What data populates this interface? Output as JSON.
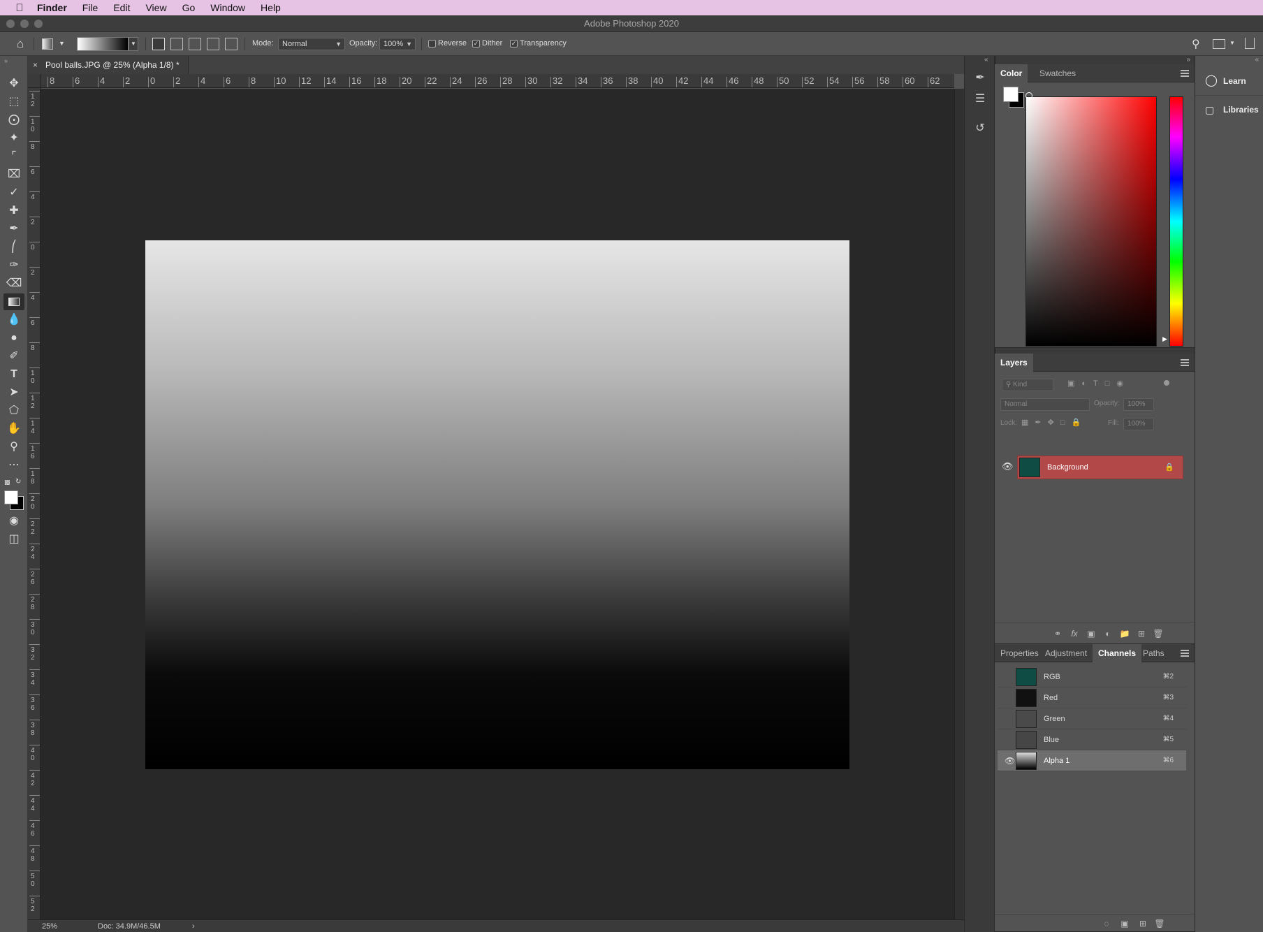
{
  "menubar": {
    "apple": "",
    "items": [
      "Finder",
      "File",
      "Edit",
      "View",
      "Go",
      "Window",
      "Help"
    ]
  },
  "window": {
    "title": "Adobe Photoshop 2020"
  },
  "options": {
    "mode_label": "Mode:",
    "mode_value": "Normal",
    "opacity_label": "Opacity:",
    "opacity_value": "100%",
    "reverse_label": "Reverse",
    "reverse_checked": false,
    "dither_label": "Dither",
    "dither_checked": true,
    "transparency_label": "Transparency",
    "transparency_checked": true
  },
  "document": {
    "tab_title": "Pool balls.JPG @ 25% (Alpha 1/8) *",
    "close_glyph": "×",
    "zoom": "25%",
    "doc_info": "Doc: 34.9M/46.5M"
  },
  "rulers": {
    "horizontal": [
      "8",
      "6",
      "4",
      "2",
      "0",
      "2",
      "4",
      "6",
      "8",
      "10",
      "12",
      "14",
      "16",
      "18",
      "20",
      "22",
      "24",
      "26",
      "28",
      "30",
      "32",
      "34",
      "36",
      "38",
      "40",
      "42",
      "44",
      "46",
      "48",
      "50",
      "52",
      "54",
      "56",
      "58",
      "60",
      "62"
    ],
    "vertical": [
      "12",
      "10",
      "8",
      "6",
      "4",
      "2",
      "0",
      "2",
      "4",
      "6",
      "8",
      "10",
      "12",
      "14",
      "16",
      "18",
      "20",
      "22",
      "24",
      "26",
      "28",
      "30",
      "32",
      "34",
      "36",
      "38",
      "40",
      "42",
      "44",
      "46",
      "48",
      "50",
      "52"
    ]
  },
  "toolbar": {
    "tools": [
      "move-tool",
      "marquee-tool",
      "lasso-tool",
      "magic-wand-tool",
      "crop-tool",
      "frame-tool",
      "eyedropper-tool",
      "healing-tool",
      "brush-tool",
      "stamp-tool",
      "history-brush-tool",
      "eraser-tool",
      "gradient-tool",
      "blur-tool",
      "dodge-tool",
      "pen-tool",
      "type-tool",
      "path-select-tool",
      "shape-tool",
      "hand-tool",
      "zoom-tool",
      "more-tools"
    ],
    "active": "gradient-tool"
  },
  "color_panel": {
    "tabs": [
      "Color",
      "Swatches"
    ],
    "active_tab": "Color",
    "foreground": "#ffffff",
    "background": "#000000"
  },
  "layers_panel": {
    "title": "Layers",
    "kind_placeholder": "Kind",
    "blend_mode": "Normal",
    "opacity_label": "Opacity:",
    "opacity_value": "100%",
    "lock_label": "Lock:",
    "fill_label": "Fill:",
    "fill_value": "100%",
    "layers": [
      {
        "name": "Background",
        "visible": true,
        "locked": true,
        "selected": true
      }
    ]
  },
  "channels_panel": {
    "tabs": [
      "Properties",
      "Adjustment",
      "Channels",
      "Paths"
    ],
    "active_tab": "Channels",
    "channels": [
      {
        "name": "RGB",
        "shortcut": "⌘2",
        "visible": false
      },
      {
        "name": "Red",
        "shortcut": "⌘3",
        "visible": false
      },
      {
        "name": "Green",
        "shortcut": "⌘4",
        "visible": false
      },
      {
        "name": "Blue",
        "shortcut": "⌘5",
        "visible": false
      },
      {
        "name": "Alpha 1",
        "shortcut": "⌘6",
        "visible": true,
        "selected": true
      }
    ]
  },
  "learn_column": {
    "items": [
      "Learn",
      "Libraries"
    ]
  },
  "colors": {
    "accent_layer": "#b24848",
    "ui_dark": "#535353",
    "canvas_bg": "#282828",
    "menubar": "#e6c3e4"
  }
}
